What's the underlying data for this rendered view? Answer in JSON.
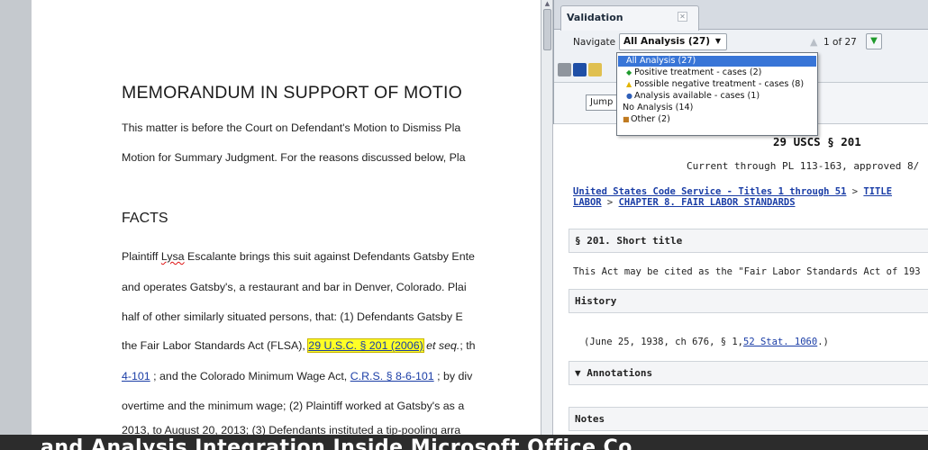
{
  "document": {
    "title": "MEMORANDUM IN SUPPORT OF MOTIO",
    "line1": "This matter is before the Court on Defendant's Motion to Dismiss Pla",
    "line2": "Motion for Summary Judgment. For the reasons discussed below, Pla",
    "facts_heading": "FACTS",
    "p1_pre": "Plaintiff ",
    "p1_name": "Lysa",
    "p1_post": " Escalante brings this suit against Defendants Gatsby Ente",
    "p2": "and operates Gatsby's, a restaurant and bar in Denver, Colorado. Plai",
    "p3": "half of other similarly situated persons, that: (1) Defendants Gatsby E",
    "p4_pre": "the Fair Labor Standards Act (FLSA), ",
    "p4_cite": "29 U.S.C. § 201 (2006)",
    "p4_italic": " et seq.",
    "p4_post": "; th",
    "p5_cite1": "4-101",
    "p5_mid": " ; and the Colorado Minimum Wage Act, ",
    "p5_cite2": "C.R.S. § 8-6-101",
    "p5_post": " ; by div",
    "p6": "overtime and the minimum wage; (2) Plaintiff worked at Gatsby's as a",
    "p7": "2013, to August 20, 2013; (3) Defendants instituted a tip-pooling arra"
  },
  "panel": {
    "tab_label": "Validation",
    "navigate_label": "Navigate",
    "navigate_value": "All Analysis (27)",
    "pager": "1 of 27",
    "jump_label": "Jump",
    "dropdown_options": [
      {
        "label": "All Analysis (27)",
        "icon": "",
        "selected": true
      },
      {
        "label": "Positive treatment - cases (2)",
        "icon": "green-diamond-icon",
        "selected": false
      },
      {
        "label": "Possible negative treatment - cases (8)",
        "icon": "yellow-triangle-icon",
        "selected": false
      },
      {
        "label": "Analysis available - cases (1)",
        "icon": "blue-circle-icon",
        "selected": false
      },
      {
        "label": "No Analysis (14)",
        "icon": "",
        "selected": false
      },
      {
        "label": "Other (2)",
        "icon": "other-icon",
        "selected": false
      }
    ]
  },
  "statute": {
    "code_title": "29 USCS § 201",
    "current": "Current through PL 113-163, approved 8/",
    "crumb_link1": "United States Code Service - Titles 1 through 51",
    "crumb_sep1": " > ",
    "crumb_link2": "TITLE",
    "crumb_link3": "LABOR",
    "crumb_sep2": " > ",
    "crumb_link4": "CHAPTER 8. FAIR LABOR STANDARDS",
    "section_heading": "§ 201. Short title",
    "section_text": "This Act may be cited as the \"Fair Labor Standards Act of 193",
    "history_heading": "History",
    "history_pre": "(June 25, 1938, ch 676, § 1,",
    "history_link": "52 Stat. 1060",
    "history_post": ".)",
    "annotations_heading": "▼  Annotations",
    "notes_heading": "Notes"
  },
  "caption": "and Analysis Integration Inside Microsoft Office Co",
  "colors": {
    "highlight": "#ffff26",
    "link": "#1a3da6",
    "selected": "#3875d7"
  }
}
